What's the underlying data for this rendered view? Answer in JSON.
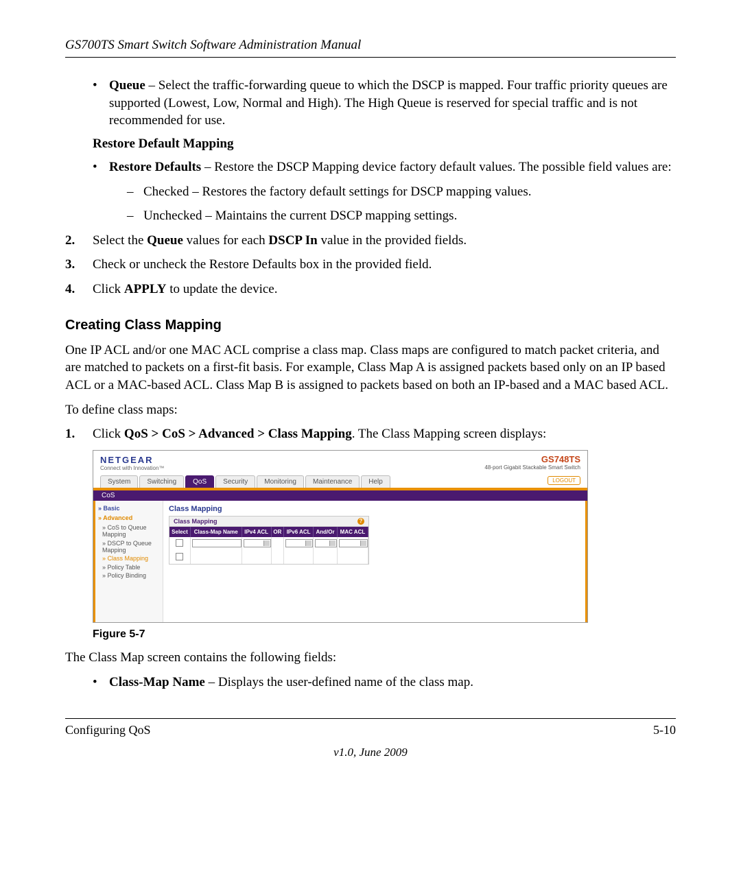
{
  "header": {
    "title": "GS700TS Smart Switch Software Administration Manual"
  },
  "content": {
    "queue_bullet_label": "Queue",
    "queue_bullet_text": " – Select the traffic-forwarding queue to which the DSCP is mapped. Four traffic priority queues are supported (Lowest, Low, Normal and High). The High Queue is reserved for special traffic and is not recommended for use.",
    "restore_heading": "Restore Default Mapping",
    "restore_bullet_label": "Restore Defaults",
    "restore_bullet_text": " – Restore the DSCP Mapping device factory default values. The possible field values are:",
    "checked_text": "Checked – Restores the factory default settings for DSCP mapping values.",
    "unchecked_text": "Unchecked – Maintains the current DSCP mapping settings.",
    "step2_num": "2.",
    "step2_a": "Select the ",
    "step2_b": "Queue",
    "step2_c": " values for each ",
    "step2_d": "DSCP In",
    "step2_e": " value in the provided fields.",
    "step3_num": "3.",
    "step3_text": "Check or uncheck the Restore Defaults box in the provided field.",
    "step4_num": "4.",
    "step4_a": "Click ",
    "step4_b": "APPLY",
    "step4_c": " to update the device.",
    "section_heading": "Creating Class Mapping",
    "section_para": "One IP ACL and/or one MAC ACL comprise a class map. Class maps are configured to match packet criteria, and are matched to packets on a first-fit basis. For example, Class Map A is assigned packets based only on an IP based ACL or a MAC-based ACL. Class Map B is assigned to packets based on both an IP-based and a MAC based ACL.",
    "to_define": "To define class maps:",
    "step1_num": "1.",
    "step1_a": "Click ",
    "step1_b": "QoS > CoS > Advanced > Class Mapping",
    "step1_c": ". The Class Mapping screen displays:",
    "figure_caption": "Figure 5-7",
    "after_fig": "The Class Map screen contains the following fields:",
    "cmname_label": "Class-Map Name",
    "cmname_text": " – Displays the user-defined name of the class map."
  },
  "figure": {
    "brand": "NETGEAR",
    "brand_sub": "Connect with Innovation™",
    "model": "GS748TS",
    "model_sub": "48-port Gigabit Stackable Smart Switch",
    "tabs": [
      "System",
      "Switching",
      "QoS",
      "Security",
      "Monitoring",
      "Maintenance",
      "Help"
    ],
    "active_tab_index": 2,
    "logout": "LOGOUT",
    "subtab": "CoS",
    "sidenav": {
      "sec1": "Basic",
      "sec2": "Advanced",
      "items": [
        "CoS to Queue Mapping",
        "DSCP to Queue Mapping",
        "Class Mapping",
        "Policy Table",
        "Policy Binding"
      ],
      "selected_index": 2
    },
    "panel": {
      "title": "Class Mapping",
      "boxtitle": "Class Mapping",
      "help": "?",
      "columns": [
        "Select",
        "Class-Map Name",
        "IPv4 ACL",
        "OR",
        "IPv6 ACL",
        "And/Or",
        "MAC ACL"
      ]
    }
  },
  "footer": {
    "left": "Configuring QoS",
    "right": "5-10",
    "center": "v1.0, June 2009"
  }
}
